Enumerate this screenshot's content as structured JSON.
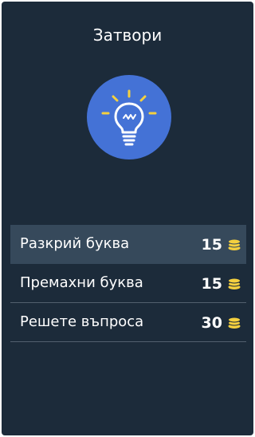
{
  "dialog": {
    "close_label": "Затвори"
  },
  "hint_icon": {
    "name": "lightbulb-icon",
    "background_color": "#4472d6",
    "ray_color": "#f4d03f"
  },
  "options": [
    {
      "label": "Разкрий буква",
      "cost": "15",
      "icon": "coins-icon",
      "highlighted": true
    },
    {
      "label": "Премахни буква",
      "cost": "15",
      "icon": "coins-icon",
      "highlighted": false
    },
    {
      "label": "Решете въпроса",
      "cost": "30",
      "icon": "coins-icon",
      "highlighted": false
    }
  ],
  "colors": {
    "panel_background": "#1c2b3a",
    "highlight_row": "#36495b",
    "divider": "#52606e",
    "coin": "#f4d03f"
  }
}
